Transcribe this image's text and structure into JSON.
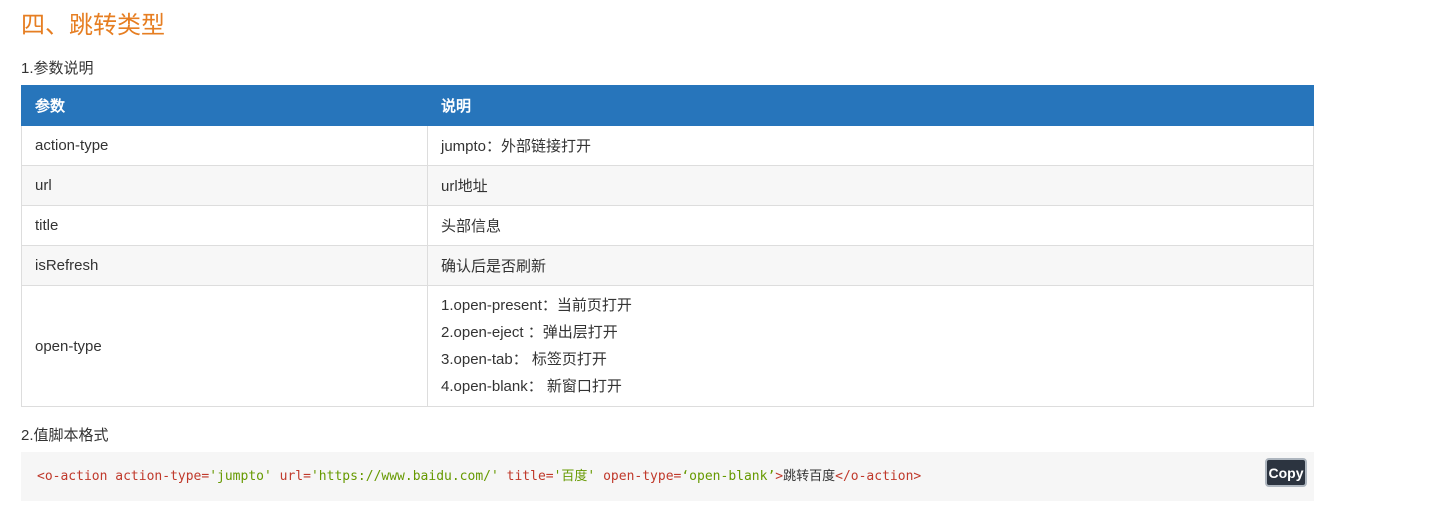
{
  "section": {
    "title": "四、跳转类型"
  },
  "params_section": {
    "subtitle": "1.参数说明",
    "headers": [
      "参数",
      "说明"
    ],
    "rows": [
      {
        "param": "action-type",
        "desc": "jumpto：外部链接打开"
      },
      {
        "param": "url",
        "desc": "url地址"
      },
      {
        "param": "title",
        "desc": "头部信息"
      },
      {
        "param": "isRefresh",
        "desc": "确认后是否刷新"
      },
      {
        "param": "open-type",
        "desc_lines": [
          "1.open-present：当前页打开",
          "2.open-eject ：弹出层打开",
          "3.open-tab： 标签页打开",
          "4.open-blank： 新窗口打开"
        ]
      }
    ]
  },
  "script_section": {
    "subtitle": "2.值脚本格式",
    "code": {
      "open_tag_start": "<o-action",
      "attr1_name": " action-type=",
      "attr1_value": "'jumpto'",
      "attr2_name": " url=",
      "attr2_value": "'https://www.baidu.com/'",
      "attr3_name": " title=",
      "attr3_value": "'百度'",
      "attr4_name": " open-type=",
      "attr4_value": "‘open-blank’",
      "open_tag_end": ">",
      "text": "跳转百度",
      "close_tag": "</o-action>"
    },
    "copy_label": "Copy"
  },
  "colors": {
    "title": "#e67e22",
    "table_header": "#2775bb",
    "code_tag": "#c0392b",
    "code_string": "#669900",
    "copy_button_bg": "#2c3440"
  }
}
